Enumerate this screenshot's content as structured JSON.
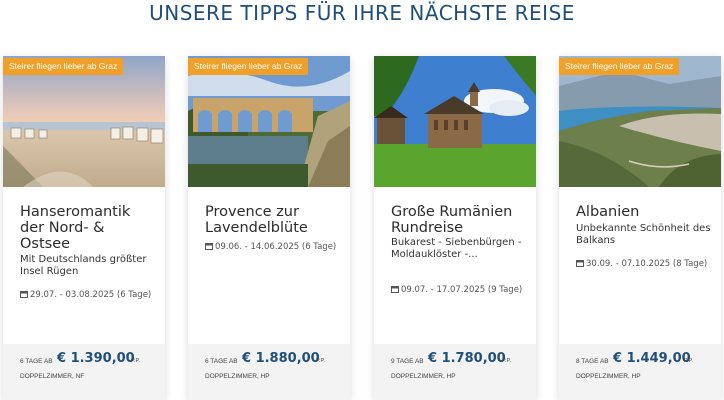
{
  "heading": "UNSERE TIPPS FÜR IHRE NÄCHSTE REISE",
  "icons": {
    "date": "calendar-icon"
  },
  "colors": {
    "heading": "#1f4f7a",
    "badge": "#f0a028",
    "price": "#1f4f7a"
  },
  "cards": [
    {
      "badge": "Steirer fliegen lieber ab Graz",
      "title": "Hanseromantik der Nord- & Ostsee",
      "subtitle": "Mit Deutschlands größter Insel Rügen",
      "date": "29.07. - 03.08.2025 (6 Tage)",
      "days": "6 TAGE AB",
      "price": "€ 1.390,00",
      "per_person": "P.P.",
      "room": "DOPPELZIMMER, NF"
    },
    {
      "badge": "Steirer fliegen lieber ab Graz",
      "title": "Provence zur Lavendelblüte",
      "subtitle": "",
      "date": "09.06. - 14.06.2025 (6 Tage)",
      "days": "6 TAGE AB",
      "price": "€ 1.880,00",
      "per_person": "P.P.",
      "room": "DOPPELZIMMER, HP"
    },
    {
      "badge": "",
      "title": "Große Rumänien Rundreise",
      "subtitle": "Bukarest - Siebenbürgen - Moldauklöster -...",
      "date": "09.07. - 17.07.2025 (9 Tage)",
      "days": "9 TAGE AB",
      "price": "€ 1.780,00",
      "per_person": "P.P.",
      "room": "DOPPELZIMMER, HP"
    },
    {
      "badge": "Steirer fliegen lieber ab Graz",
      "title": "Albanien",
      "subtitle": "Unbekannte Schönheit des Balkans",
      "date": "30.09. - 07.10.2025 (8 Tage)",
      "days": "8 TAGE AB",
      "price": "€ 1.449,00",
      "per_person": "P.P.",
      "room": "DOPPELZIMMER, HP"
    }
  ]
}
